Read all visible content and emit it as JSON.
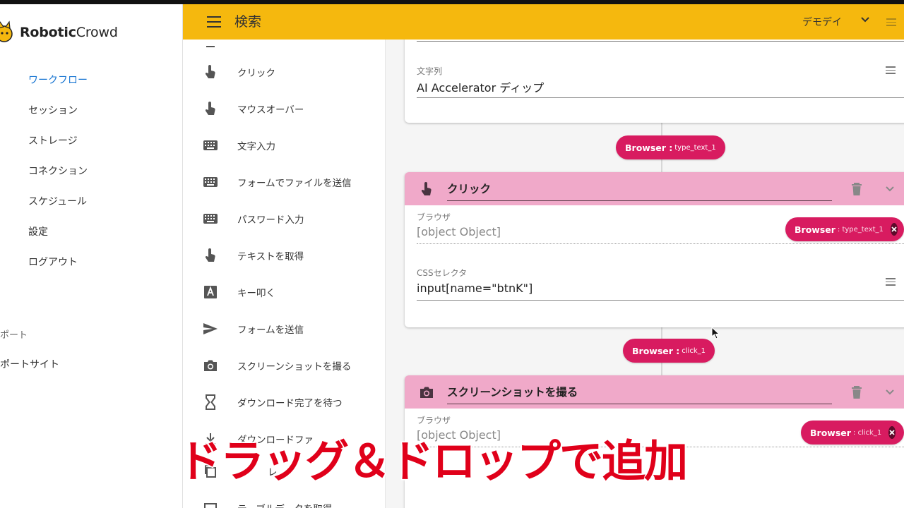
{
  "app": {
    "logo_bold": "Robotic",
    "logo_light": "Crowd"
  },
  "nav": {
    "items": [
      {
        "label": "ワークフロー",
        "active": true
      },
      {
        "label": "セッション"
      },
      {
        "label": "ストレージ"
      },
      {
        "label": "コネクション"
      },
      {
        "label": "スケジュール"
      },
      {
        "label": "設定"
      },
      {
        "label": "ログアウト"
      }
    ],
    "section_label": "ポート",
    "support_link": "ポートサイト"
  },
  "header": {
    "title": "検索",
    "user": "デモデイ",
    "accent": "#f5b80e"
  },
  "palette": {
    "items": [
      {
        "label": "クリック",
        "icon": "hand-pointer-icon"
      },
      {
        "label": "マウスオーバー",
        "icon": "hand-pointer-icon"
      },
      {
        "label": "文字入力",
        "icon": "keyboard-icon"
      },
      {
        "label": "フォームでファイルを送信",
        "icon": "keyboard-icon"
      },
      {
        "label": "パスワード入力",
        "icon": "keyboard-icon"
      },
      {
        "label": "テキストを取得",
        "icon": "hand-pointer-icon"
      },
      {
        "label": "キー叩く",
        "icon": "letter-a-icon"
      },
      {
        "label": "フォームを送信",
        "icon": "send-icon"
      },
      {
        "label": "スクリーンショットを撮る",
        "icon": "camera-icon"
      },
      {
        "label": "ダウンロード完了を待つ",
        "icon": "hourglass-icon"
      },
      {
        "label": "ダウンロードファ",
        "icon": "download-icon"
      },
      {
        "label": "レ",
        "icon": "copy-icon"
      },
      {
        "label": "テーブルデータを取得",
        "icon": "table-icon"
      }
    ]
  },
  "canvas": {
    "text_card": {
      "label": "文字列",
      "value": "AI Accelerator ディップ"
    },
    "connector_chip_1": {
      "main": "Browser :",
      "sub": "type_text_1"
    },
    "click_card": {
      "title": "クリック",
      "browser_label": "ブラウザ",
      "browser_value": "[object Object]",
      "browser_chip": {
        "main": "Browser",
        "sub": ": type_text_1"
      },
      "selector_label": "CSSセレクタ",
      "selector_value": "input[name=\"btnK\"]"
    },
    "connector_chip_2": {
      "main": "Browser :",
      "sub": "click_1"
    },
    "screenshot_card": {
      "title": "スクリーンショットを撮る",
      "browser_label": "ブラウザ",
      "browser_value": "[object Object]",
      "browser_chip": {
        "main": "Browser",
        "sub": ": click_1"
      }
    },
    "chip_color": "#d81b60",
    "card_header_color": "#f0a9c9"
  },
  "overlay": {
    "caption": "ドラッグ＆ドロップで追加"
  }
}
